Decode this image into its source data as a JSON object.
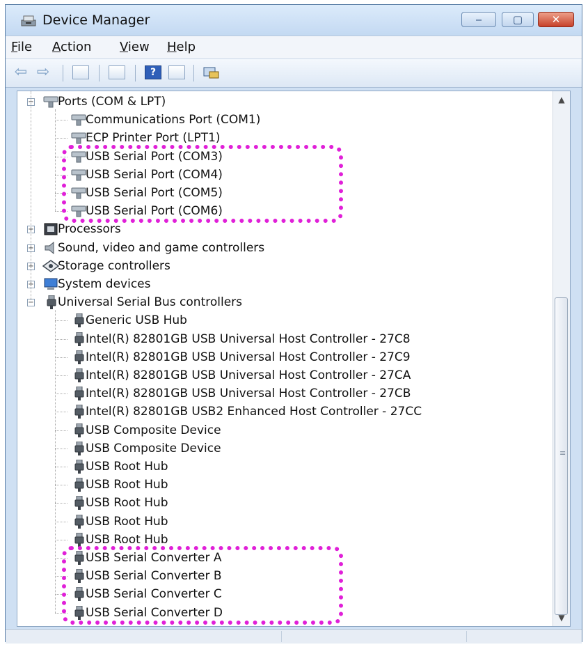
{
  "window": {
    "title": "Device Manager"
  },
  "menubar": {
    "items": [
      {
        "key": "F",
        "rest": "ile"
      },
      {
        "key": "A",
        "rest": "ction"
      },
      {
        "key": "V",
        "rest": "iew"
      },
      {
        "key": "H",
        "rest": "elp"
      }
    ]
  },
  "toolbar": {
    "buttons": [
      "back-icon",
      "forward-icon",
      "console-tree-icon",
      "properties-icon",
      "help-icon",
      "view-icon",
      "scan-hardware-icon"
    ]
  },
  "tree": {
    "ports": {
      "label": "Ports (COM & LPT)",
      "children": [
        "Communications Port (COM1)",
        "ECP Printer Port (LPT1)",
        "USB Serial Port (COM3)",
        "USB Serial Port (COM4)",
        "USB Serial Port (COM5)",
        "USB Serial Port (COM6)"
      ]
    },
    "collapsed": [
      {
        "label": "Processors",
        "icon": "processor-icon"
      },
      {
        "label": "Sound, video and game controllers",
        "icon": "speaker-icon"
      },
      {
        "label": "Storage controllers",
        "icon": "storage-icon"
      },
      {
        "label": "System devices",
        "icon": "computer-icon"
      }
    ],
    "usb": {
      "label": "Universal Serial Bus controllers",
      "children": [
        "Generic USB Hub",
        "Intel(R) 82801GB USB Universal Host Controller - 27C8",
        "Intel(R) 82801GB USB Universal Host Controller - 27C9",
        "Intel(R) 82801GB USB Universal Host Controller - 27CA",
        "Intel(R) 82801GB USB Universal Host Controller - 27CB",
        "Intel(R) 82801GB USB2 Enhanced Host Controller - 27CC",
        "USB Composite Device",
        "USB Composite Device",
        "USB Root Hub",
        "USB Root Hub",
        "USB Root Hub",
        "USB Root Hub",
        "USB Root Hub",
        "USB Serial Converter A",
        "USB Serial Converter B",
        "USB Serial Converter C",
        "USB Serial Converter D"
      ]
    }
  },
  "colors": {
    "highlight": "#e020d8",
    "titlebar": "#c3d9f2"
  }
}
